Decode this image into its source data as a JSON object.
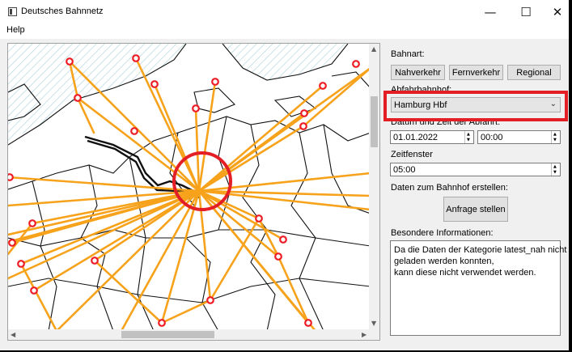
{
  "window": {
    "title": "Deutsches Bahnnetz",
    "minimize_glyph": "—",
    "maximize_glyph": "☐",
    "close_glyph": "✕"
  },
  "menu": {
    "help": "Help"
  },
  "panel": {
    "bahnart_label": "Bahnart:",
    "buttons": {
      "nahverkehr": "Nahverkehr",
      "fernverkehr": "Fernverkehr",
      "regional": "Regional"
    },
    "abfahrtbahnhof_label": "Abfahrbahnhof:",
    "station_selected": "Hamburg Hbf",
    "datetime_label": "Datum und Zeit der Abfahrt:",
    "date_value": "01.01.2022",
    "time_value": "00:00",
    "zeitfenster_label": "Zeitfenster",
    "zeitfenster_value": "05:00",
    "daten_label": "Daten zum Bahnhof erstellen:",
    "anfrage_button": "Anfrage stellen",
    "besondere_label": "Besondere Informationen:",
    "info_lines": [
      "Da die Daten der Kategorie latest_nah nicht",
      "geladen werden konnten,",
      "kann diese nicht verwendet werden."
    ]
  },
  "map": {
    "route_color": "#f7a21b",
    "station_color": "#ee1c25",
    "highlight_color": "#e31e24"
  }
}
